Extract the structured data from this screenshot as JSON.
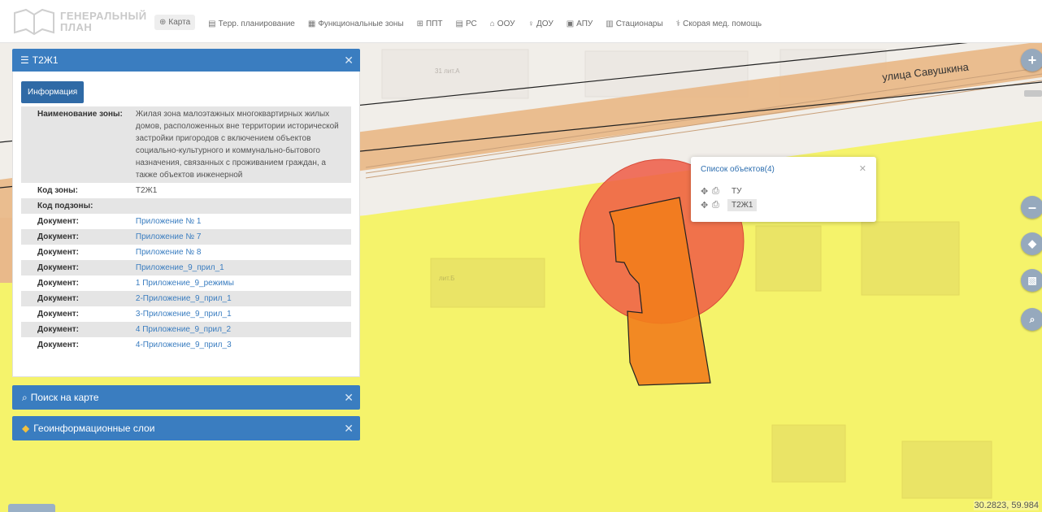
{
  "header": {
    "logo_line1": "ГЕНЕРАЛЬНЫЙ",
    "logo_line2": "ПЛАН",
    "nav": [
      {
        "icon": "globe-icon",
        "glyph": "⊕",
        "label": "Карта"
      },
      {
        "icon": "document-icon",
        "glyph": "▤",
        "label": "Терр. планирование"
      },
      {
        "icon": "grid-icon",
        "glyph": "▦",
        "label": "Функциональные зоны"
      },
      {
        "icon": "table-icon",
        "glyph": "⊞",
        "label": "ППТ"
      },
      {
        "icon": "sheet-icon",
        "glyph": "▤",
        "label": "РС"
      },
      {
        "icon": "school-icon",
        "glyph": "⌂",
        "label": "ООУ"
      },
      {
        "icon": "kindergarten-icon",
        "glyph": "♀",
        "label": "ДОУ"
      },
      {
        "icon": "image-icon",
        "glyph": "▣",
        "label": "АПУ"
      },
      {
        "icon": "hospital-icon",
        "glyph": "▥",
        "label": "Стационары"
      },
      {
        "icon": "ambulance-icon",
        "glyph": "⚕",
        "label": "Скорая мед. помощь"
      }
    ]
  },
  "map": {
    "street_label": "улица Савушкина",
    "building_label_1": "31 лит.А",
    "building_label_2": "лит.Б",
    "coords": "30.2823, 59.984",
    "colors": {
      "yellow_zone": "#f5f36b",
      "road": "#e9b98a",
      "circle": "#ef4a3c",
      "building": "#f07a1a",
      "accent": "#3a7dc0"
    }
  },
  "popup": {
    "title": "Список объектов(4)",
    "rows": [
      {
        "label": "ТУ"
      },
      {
        "label": "Т2Ж1"
      }
    ]
  },
  "panel": {
    "title": "Т2Ж1",
    "tab": "Информация",
    "rows": [
      {
        "key": "Наименование зоны:",
        "value": "Жилая зона малоэтажных многоквартирных жилых домов, расположенных вне территории исторической застройки пригородов с включением объектов социально-культурного и коммунально-бытового назначения, связанных с проживанием граждан, а также объектов инженерной"
      },
      {
        "key": "Код зоны:",
        "value": "Т2Ж1"
      },
      {
        "key": "Код подзоны:",
        "value": ""
      },
      {
        "key": "Документ:",
        "value": "Приложение № 1"
      },
      {
        "key": "Документ:",
        "value": "Приложение № 7"
      },
      {
        "key": "Документ:",
        "value": "Приложение № 8"
      },
      {
        "key": "Документ:",
        "value": "Приложение_9_прил_1"
      },
      {
        "key": "Документ:",
        "value": "1 Приложение_9_режимы"
      },
      {
        "key": "Документ:",
        "value": "2-Приложение_9_прил_1"
      },
      {
        "key": "Документ:",
        "value": "3-Приложение_9_прил_1"
      },
      {
        "key": "Документ:",
        "value": "4 Приложение_9_прил_2"
      },
      {
        "key": "Документ:",
        "value": "4-Приложение_9_прил_3"
      }
    ]
  },
  "search_panel": {
    "title": "Поиск на карте"
  },
  "layers_panel": {
    "title": "Геоинформационные слои"
  }
}
